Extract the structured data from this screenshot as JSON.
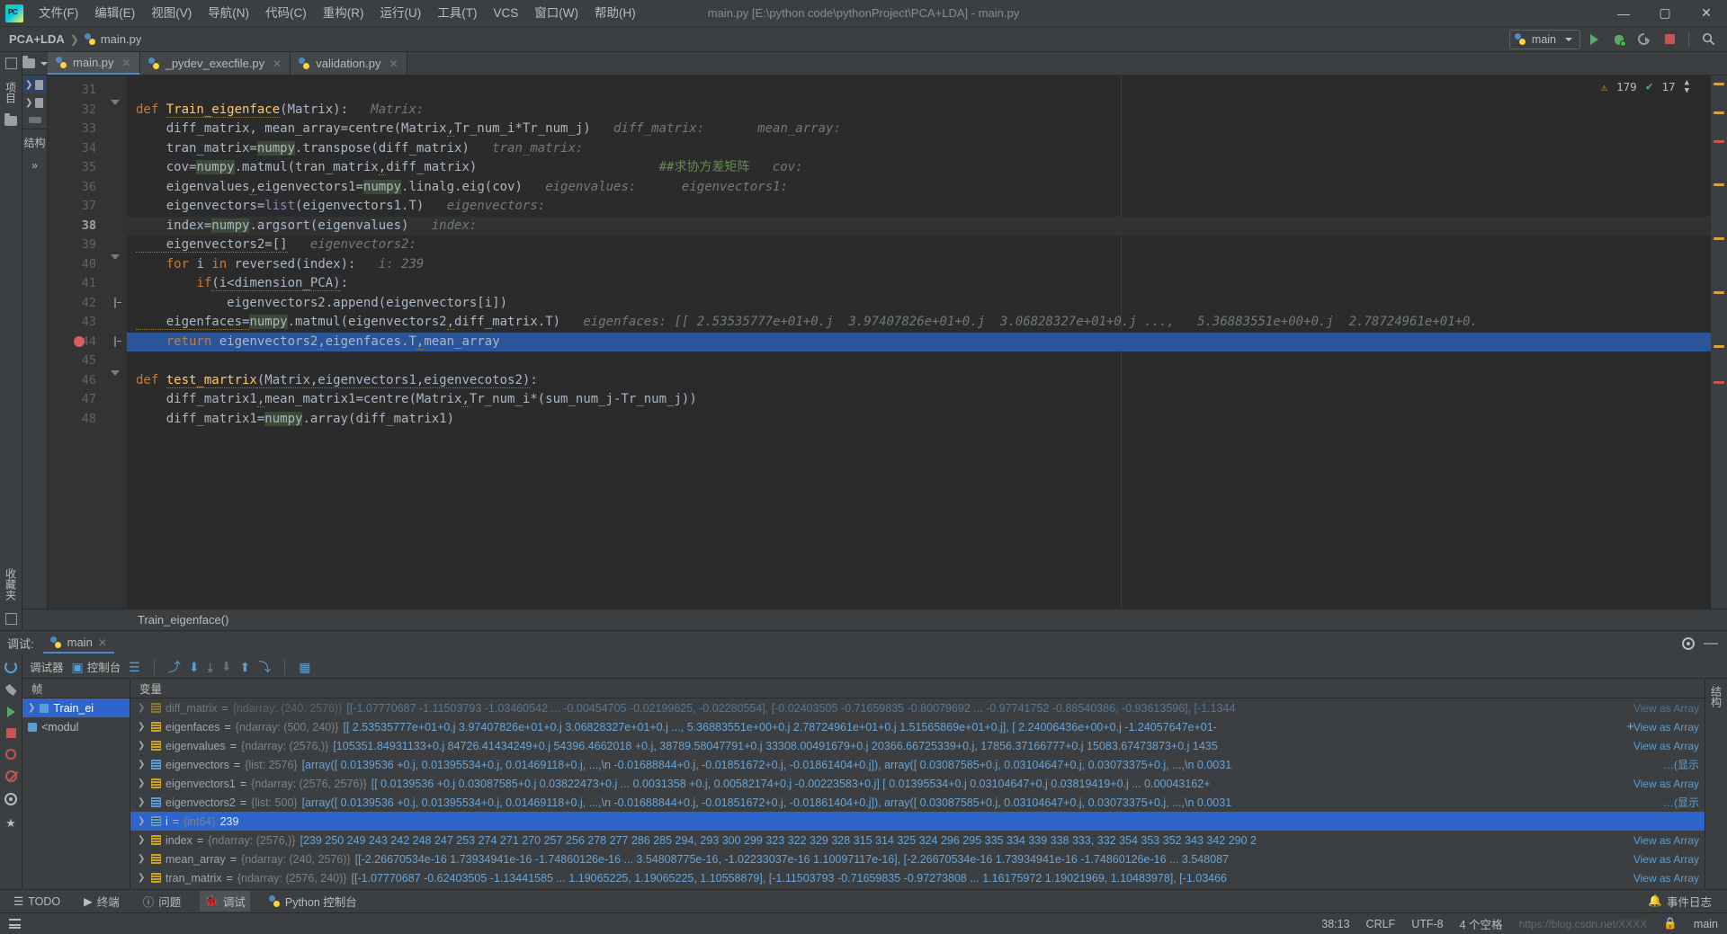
{
  "titlebar": {
    "logo_name": "pycharm-logo",
    "menus": [
      {
        "label": "文件(F)"
      },
      {
        "label": "编辑(E)"
      },
      {
        "label": "视图(V)"
      },
      {
        "label": "导航(N)"
      },
      {
        "label": "代码(C)"
      },
      {
        "label": "重构(R)"
      },
      {
        "label": "运行(U)"
      },
      {
        "label": "工具(T)"
      },
      {
        "label": "VCS"
      },
      {
        "label": "窗口(W)"
      },
      {
        "label": "帮助(H)"
      }
    ],
    "window_title": "main.py [E:\\python code\\pythonProject\\PCA+LDA] - main.py",
    "minimize": "—",
    "maximize": "▢",
    "close": "✕"
  },
  "navbar": {
    "project_crumb": "PCA+LDA",
    "separator": "❯",
    "file_crumb": "main.py",
    "run_config": "main",
    "run_tooltip": "运行",
    "debug_tooltip": "调试",
    "coverage_tooltip": "运行覆盖率",
    "stop_tooltip": "停止",
    "search_tooltip": "搜索"
  },
  "left_strip": {
    "project_tab": "项目",
    "structure_tab": "结构",
    "favorites_tab": "收藏夹"
  },
  "tabs": [
    {
      "label": "main.py",
      "active": true
    },
    {
      "label": "_pydev_execfile.py",
      "active": false
    },
    {
      "label": "validation.py",
      "active": false
    }
  ],
  "editor": {
    "warning_count": "179",
    "ok_count": "17",
    "breadcrumb": "Train_eigenface()",
    "caret_position": "38:13",
    "lines": [
      {
        "num": "31",
        "segments": []
      },
      {
        "num": "32",
        "fold": "tri",
        "segments": [
          {
            "t": "def ",
            "c": "kw"
          },
          {
            "t": "Train_eigenface",
            "c": "fn err"
          },
          {
            "t": "(Matrix):",
            "c": ""
          },
          {
            "t": "   Matrix:",
            "c": "hint"
          }
        ]
      },
      {
        "num": "33",
        "segments": [
          {
            "t": "    diff_matrix, mean_array=centre(Matrix,Tr_num_i*Tr_num_j)",
            "c": ""
          },
          {
            "t": "   diff_matrix:       mean_array:",
            "c": "hint"
          }
        ]
      },
      {
        "num": "34",
        "segments": [
          {
            "t": "    tran_matrix=",
            "c": ""
          },
          {
            "t": "numpy",
            "c": "hl"
          },
          {
            "t": ".transpose(diff_matrix)",
            "c": ""
          },
          {
            "t": "   tran_matrix:",
            "c": "hint"
          }
        ]
      },
      {
        "num": "35",
        "segments": [
          {
            "t": "    cov=",
            "c": ""
          },
          {
            "t": "numpy",
            "c": "hl"
          },
          {
            "t": ".matmul(tran_matrix,diff_matrix)",
            "c": ""
          },
          {
            "t": "                        ##求协方差矩阵",
            "c": "cmt"
          },
          {
            "t": "   cov:",
            "c": "hint"
          }
        ]
      },
      {
        "num": "36",
        "segments": [
          {
            "t": "    eigenvalues,eigenvectors1=",
            "c": ""
          },
          {
            "t": "numpy",
            "c": "hl"
          },
          {
            "t": ".linalg.eig(cov)",
            "c": ""
          },
          {
            "t": "   eigenvalues:      eigenvectors1:",
            "c": "hint"
          }
        ]
      },
      {
        "num": "37",
        "segments": [
          {
            "t": "    eigenvectors=",
            "c": ""
          },
          {
            "t": "list",
            "c": "bi"
          },
          {
            "t": "(eigenvectors1.T)",
            "c": ""
          },
          {
            "t": "   eigenvectors:",
            "c": "hint"
          }
        ]
      },
      {
        "num": "38",
        "current": true,
        "segments": [
          {
            "t": "    index=",
            "c": ""
          },
          {
            "t": "numpy",
            "c": "hl"
          },
          {
            "t": ".argsort(eigenvalues)",
            "c": ""
          },
          {
            "t": "   index:",
            "c": "hint"
          }
        ]
      },
      {
        "num": "39",
        "segments": [
          {
            "t": "    eigenvectors2=[]",
            "c": ""
          },
          {
            "t": "   eigenvectors2:",
            "c": "hint"
          }
        ]
      },
      {
        "num": "40",
        "fold": "tri",
        "segments": [
          {
            "t": "    ",
            "c": ""
          },
          {
            "t": "for",
            "c": "kw"
          },
          {
            "t": " i ",
            "c": ""
          },
          {
            "t": "in",
            "c": "kw"
          },
          {
            "t": " reversed(index):",
            "c": ""
          },
          {
            "t": "   i: 239",
            "c": "hint"
          }
        ]
      },
      {
        "num": "41",
        "segments": [
          {
            "t": "        ",
            "c": ""
          },
          {
            "t": "if",
            "c": "kw"
          },
          {
            "t": "(i<dimension_PCA):",
            "c": ""
          }
        ]
      },
      {
        "num": "42",
        "fold": "box",
        "segments": [
          {
            "t": "            eigenvectors2.append(eigenvectors[i])",
            "c": ""
          }
        ]
      },
      {
        "num": "43",
        "segments": [
          {
            "t": "    eigenfaces=",
            "c": ""
          },
          {
            "t": "numpy",
            "c": "hl"
          },
          {
            "t": ".matmul(eigenvectors2,diff_matrix.T)",
            "c": ""
          },
          {
            "t": "   eigenfaces: [[ 2.53535777e+01+0.j  3.97407826e+01+0.j  3.06828327e+01+0.j ...,   5.36883551e+00+0.j  2.78724961e+01+0.",
            "c": "hint"
          }
        ]
      },
      {
        "num": "44",
        "breakpoint": true,
        "selected": true,
        "fold": "box",
        "segments": [
          {
            "t": "    ",
            "c": ""
          },
          {
            "t": "return",
            "c": "kw"
          },
          {
            "t": " eigenvectors2,eigenfaces.T,mean_array",
            "c": ""
          }
        ]
      },
      {
        "num": "45",
        "segments": []
      },
      {
        "num": "46",
        "fold": "tri",
        "segments": [
          {
            "t": "def ",
            "c": "kw"
          },
          {
            "t": "test_martrix",
            "c": "fn err"
          },
          {
            "t": "(Matrix,eigenvectors1,eigenvecotos2):",
            "c": ""
          }
        ]
      },
      {
        "num": "47",
        "segments": [
          {
            "t": "    diff_matrix1,mean_matrix1=centre(Matrix,Tr_num_i*(sum_num_j-Tr_num_j))",
            "c": ""
          }
        ]
      },
      {
        "num": "48",
        "segments": [
          {
            "t": "    diff_matrix1=",
            "c": ""
          },
          {
            "t": "numpy",
            "c": "hl"
          },
          {
            "t": ".array(diff_matrix1)",
            "c": ""
          }
        ]
      }
    ]
  },
  "debug": {
    "panel_label": "调试:",
    "session_tab": "main",
    "toolbar": {
      "debugger_tab": "调试器",
      "console_tab": "控制台",
      "mute_breakpoints": "静音断点",
      "step_over": "步过",
      "step_into": "步入",
      "force_step_into": "强制步入",
      "step_out_disabled": "步出",
      "step_out": "步出",
      "run_to_cursor": "运行到光标处",
      "evaluate": "计算表达式"
    },
    "frames_header": "帧",
    "vars_header": "变量",
    "frames": [
      {
        "label": "Train_ei",
        "selected": true
      },
      {
        "label": "<modul",
        "selected": false
      }
    ],
    "view_as_array": "View as Array",
    "show_link": "…(显示",
    "variables": [
      {
        "name": "diff_matrix",
        "type": "{ndarray: (240, 2576)}",
        "value": "[[-1.07770687 -1.11503793 -1.03460542 ... -0.00454705 -0.02199625, -0.02280554], [-0.02403505 -0.71659835 -0.80079692 ... -0.97741752 -0.88540386, -0.93613596], [-1.1344",
        "selected": false,
        "clipped": true
      },
      {
        "name": "eigenfaces",
        "type": "{ndarray: (500, 240)}",
        "value": "[[ 2.53535777e+01+0.j 3.97407826e+01+0.j 3.06828327e+01+0.j ...,  5.36883551e+00+0.j 2.78724961e+01+0.j 1.51565869e+01+0.j], [ 2.24006436e+00+0.j -1.24057647e+01-",
        "selected": false
      },
      {
        "name": "eigenvalues",
        "type": "{ndarray: (2576,)}",
        "value": "[105351.84931133+0.j 84726.41434249+0.j 54396.4662018 +0.j, 38789.58047791+0.j 33308.00491679+0.j 20366.66725339+0.j, 17856.37166777+0.j 15083.67473873+0.j 1435",
        "selected": false
      },
      {
        "name": "eigenvectors",
        "type": "{list: 2576}",
        "value": "[array([ 0.0139536 +0.j, 0.01395534+0.j, 0.01469118+0.j, ...,\\n   -0.01688844+0.j, -0.01851672+0.j, -0.01861404+0.j]), array([ 0.03087585+0.j, 0.03104647+0.j, 0.03073375+0.j, ...,\\n   0.0031",
        "selected": false,
        "trailing": "…(显示"
      },
      {
        "name": "eigenvectors1",
        "type": "{ndarray: (2576, 2576)}",
        "value": "[[ 0.0139536 +0.j 0.03087585+0.j 0.03822473+0.j ...  0.0031358 +0.j, 0.00582174+0.j -0.00223583+0.j] [ 0.01395534+0.j 0.03104647+0.j 0.03819419+0.j ...  0.00043162+",
        "selected": false
      },
      {
        "name": "eigenvectors2",
        "type": "{list: 500}",
        "value": "[array([ 0.0139536 +0.j, 0.01395534+0.j, 0.01469118+0.j, ...,\\n   -0.01688844+0.j, -0.01851672+0.j, -0.01861404+0.j]), array([ 0.03087585+0.j, 0.03104647+0.j, 0.03073375+0.j, ...,\\n   0.0031",
        "selected": false,
        "trailing": "…(显示"
      },
      {
        "name": "i",
        "type": "{int64}",
        "value": "239",
        "selected": true,
        "is_scalar": true
      },
      {
        "name": "index",
        "type": "{ndarray: (2576,)}",
        "value": "[239 250 249 243 242 248 247 253 274 271 270 257 256 278 277 286 285 294, 293 300 299 323 322 329 328 315 314 325 324 296 295 335 334 339 338 333, 332 354 353 352 343 342 290 2",
        "selected": false
      },
      {
        "name": "mean_array",
        "type": "{ndarray: (240, 2576)}",
        "value": "[[-2.26670534e-16  1.73934941e-16 -1.74860126e-16 ...  3.54808775e-16, -1.02233037e-16  1.10097117e-16], [-2.26670534e-16  1.73934941e-16 -1.74860126e-16 ...  3.548087",
        "selected": false
      },
      {
        "name": "tran_matrix",
        "type": "{ndarray: (2576, 240)}",
        "value": "[[-1.07770687 -0.62403505 -1.13441585 ...  1.19065225,  1.19065225,  1.10558879], [-1.11503793 -0.71659835 -0.97273808 ...  1.16175972  1.19021969,  1.10483978], [-1.03466",
        "selected": false
      }
    ]
  },
  "bottom_bar": {
    "items": [
      {
        "label": "TODO",
        "icon": "todo-icon",
        "active": false
      },
      {
        "label": "终端",
        "icon": "terminal-icon",
        "active": false
      },
      {
        "label": "问题",
        "icon": "problems-icon",
        "active": false
      },
      {
        "label": "调试",
        "icon": "debug-icon",
        "active": true
      },
      {
        "label": "Python 控制台",
        "icon": "python-icon",
        "active": false
      }
    ],
    "event_log": "事件日志"
  },
  "statusbar": {
    "caret": "38:13",
    "line_sep": "CRLF",
    "encoding": "UTF-8",
    "indent": "4 个空格",
    "branch": "main",
    "watermark": "https://blog.csdn.net/XXXX",
    "lock": "🔒"
  }
}
